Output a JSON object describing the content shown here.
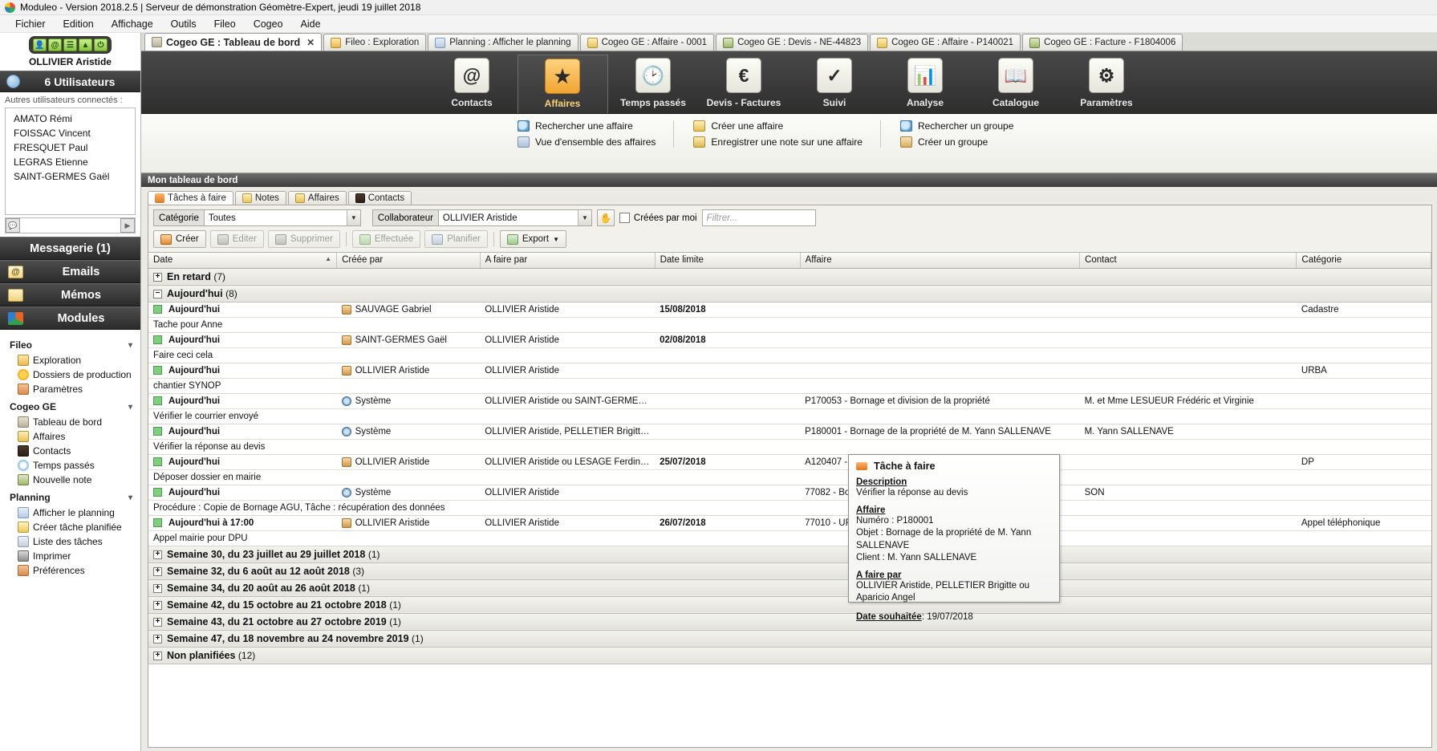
{
  "window": {
    "title": "Moduleo - Version 2018.2.5 | Serveur de démonstration Géomètre-Expert, jeudi 19 juillet 2018",
    "logo_icon": "moduleo-logo-icon"
  },
  "menubar": [
    "Fichier",
    "Edition",
    "Affichage",
    "Outils",
    "Fileo",
    "Cogeo",
    "Aide"
  ],
  "sidebar": {
    "quick_icons": [
      "user-icon",
      "at-icon",
      "contacts-icon",
      "map-icon",
      "power-icon"
    ],
    "current_user": "OLLIVIER Aristide",
    "users_header": "6 Utilisateurs",
    "connected_label": "Autres utilisateurs connectés :",
    "connected_users": [
      "AMATO Rémi",
      "FOISSAC Vincent",
      "FRESQUET Paul",
      "LEGRAS Etienne",
      "SAINT-GERMES Gaël"
    ],
    "bars": [
      {
        "label": "Messagerie (1)",
        "icon": ""
      },
      {
        "label": "Emails",
        "icon": "at-icon"
      },
      {
        "label": "Mémos",
        "icon": "memo-icon"
      },
      {
        "label": "Modules",
        "icon": "modules-icon"
      }
    ],
    "groups": [
      {
        "title": "Fileo",
        "items": [
          {
            "label": "Exploration",
            "icon": "folder-explore-icon"
          },
          {
            "label": "Dossiers de production",
            "icon": "star-icon"
          },
          {
            "label": "Paramètres",
            "icon": "wrench-icon"
          }
        ]
      },
      {
        "title": "Cogeo GE",
        "items": [
          {
            "label": "Tableau de bord",
            "icon": "home-icon"
          },
          {
            "label": "Affaires",
            "icon": "affair-folder-icon"
          },
          {
            "label": "Contacts",
            "icon": "contacts-book-icon"
          },
          {
            "label": "Temps passés",
            "icon": "clock-icon"
          },
          {
            "label": "Nouvelle note",
            "icon": "new-note-icon"
          }
        ]
      },
      {
        "title": "Planning",
        "items": [
          {
            "label": "Afficher le planning",
            "icon": "calendar-icon"
          },
          {
            "label": "Créer tâche planifiée",
            "icon": "task-icon"
          },
          {
            "label": "Liste des tâches",
            "icon": "list-icon"
          },
          {
            "label": "Imprimer",
            "icon": "printer-icon"
          },
          {
            "label": "Préférences",
            "icon": "preferences-icon"
          }
        ]
      }
    ]
  },
  "tabs": [
    {
      "label": "Cogeo GE : Tableau de bord",
      "icon": "home-icon",
      "active": true,
      "closable": true
    },
    {
      "label": "Fileo : Exploration",
      "icon": "folder-explore-icon",
      "active": false
    },
    {
      "label": "Planning : Afficher le planning",
      "icon": "calendar-icon",
      "active": false
    },
    {
      "label": "Cogeo GE : Affaire - 0001",
      "icon": "affair-folder-icon",
      "active": false
    },
    {
      "label": "Cogeo GE : Devis - NE-44823",
      "icon": "quote-icon",
      "active": false
    },
    {
      "label": "Cogeo GE : Affaire - P140021",
      "icon": "affair-folder-icon",
      "active": false
    },
    {
      "label": "Cogeo GE : Facture - F1804006",
      "icon": "invoice-icon",
      "active": false
    }
  ],
  "ribbon": [
    {
      "label": "Contacts",
      "glyph": "@",
      "icon": "contacts-icon",
      "active": false
    },
    {
      "label": "Affaires",
      "glyph": "★",
      "icon": "affairs-icon",
      "active": true
    },
    {
      "label": "Temps passés",
      "glyph": "◷",
      "icon": "clock-icon",
      "active": false
    },
    {
      "label": "Devis - Factures",
      "glyph": "€",
      "icon": "euro-icon",
      "active": false
    },
    {
      "label": "Suivi",
      "glyph": "✓",
      "icon": "check-icon",
      "active": false
    },
    {
      "label": "Analyse",
      "glyph": "▊",
      "icon": "chart-icon",
      "active": false
    },
    {
      "label": "Catalogue",
      "glyph": "▤",
      "icon": "book-icon",
      "active": false
    },
    {
      "label": "Paramètres",
      "glyph": "✿",
      "icon": "gear-icon",
      "active": false
    }
  ],
  "quick_links": {
    "col1": [
      {
        "label": "Rechercher une affaire",
        "icon": "search-icon"
      },
      {
        "label": "Vue d'ensemble des affaires",
        "icon": "grid-icon"
      }
    ],
    "col2": [
      {
        "label": "Créer une affaire",
        "icon": "new-affair-icon"
      },
      {
        "label": "Enregistrer une note sur une affaire",
        "icon": "note-icon"
      }
    ],
    "col3": [
      {
        "label": "Rechercher un groupe",
        "icon": "search-icon"
      },
      {
        "label": "Créer un groupe",
        "icon": "new-group-icon"
      }
    ]
  },
  "dashboard": {
    "title": "Mon tableau de bord",
    "inner_tabs": [
      {
        "label": "Tâches à faire",
        "icon": "arrow-icon",
        "active": true
      },
      {
        "label": "Notes",
        "icon": "note-icon",
        "active": false
      },
      {
        "label": "Affaires",
        "icon": "affair-folder-icon",
        "active": false
      },
      {
        "label": "Contacts",
        "icon": "contacts-book-icon",
        "active": false
      }
    ],
    "filters": {
      "categorie_label": "Catégorie",
      "categorie_value": "Toutes",
      "collaborateur_label": "Collaborateur",
      "collaborateur_value": "OLLIVIER Aristide",
      "hand_icon": "hand-icon",
      "creees_par_moi_label": "Créées par moi",
      "creees_par_moi_checked": false,
      "filter_placeholder": "Filtrer..."
    },
    "buttons": [
      {
        "label": "Créer",
        "icon": "create-icon",
        "disabled": false
      },
      {
        "label": "Editer",
        "icon": "edit-icon",
        "disabled": true
      },
      {
        "label": "Supprimer",
        "icon": "delete-icon",
        "disabled": true
      },
      {
        "label": "Effectuée",
        "icon": "done-icon",
        "disabled": true
      },
      {
        "label": "Planifier",
        "icon": "plan-icon",
        "disabled": true
      },
      {
        "label": "Export",
        "icon": "export-icon",
        "disabled": false,
        "dropdown": true
      }
    ],
    "columns": [
      "Date",
      "Créée par",
      "A faire par",
      "Date limite",
      "Affaire",
      "Contact",
      "Catégorie"
    ],
    "sort_column": "Date",
    "rows": [
      {
        "type": "group",
        "label": "En retard",
        "count": "(7)",
        "expanded": false
      },
      {
        "type": "group",
        "label": "Aujourd'hui",
        "count": "(8)",
        "expanded": true
      },
      {
        "type": "task",
        "date": "Aujourd'hui",
        "creee_par": "SAUVAGE Gabriel",
        "creator_icon": "person-icon",
        "a_faire_par": "OLLIVIER Aristide",
        "date_limite": "15/08/2018",
        "affaire": "",
        "contact": "",
        "categorie": "Cadastre"
      },
      {
        "type": "sub",
        "text": "Tache pour Anne"
      },
      {
        "type": "task",
        "date": "Aujourd'hui",
        "creee_par": "SAINT-GERMES Gaël",
        "creator_icon": "person-icon",
        "a_faire_par": "OLLIVIER Aristide",
        "date_limite": "02/08/2018",
        "affaire": "",
        "contact": "",
        "categorie": ""
      },
      {
        "type": "sub",
        "text": "Faire ceci cela"
      },
      {
        "type": "task",
        "date": "Aujourd'hui",
        "creee_par": "OLLIVIER Aristide",
        "creator_icon": "person-icon",
        "a_faire_par": "OLLIVIER Aristide",
        "date_limite": "",
        "affaire": "",
        "contact": "",
        "categorie": "URBA"
      },
      {
        "type": "sub",
        "text": "chantier SYNOP"
      },
      {
        "type": "task",
        "date": "Aujourd'hui",
        "creee_par": "Système",
        "creator_icon": "system-icon",
        "a_faire_par": "OLLIVIER Aristide ou SAINT-GERMES Gaël",
        "date_limite": "",
        "affaire": "P170053 - Bornage et division de la propriété",
        "contact": "M. et Mme LESUEUR Frédéric et Virginie",
        "categorie": ""
      },
      {
        "type": "sub",
        "text": "Vérifier le courrier envoyé"
      },
      {
        "type": "task",
        "date": "Aujourd'hui",
        "creee_par": "Système",
        "creator_icon": "system-icon",
        "a_faire_par": "OLLIVIER Aristide, PELLETIER Brigitte ou A...",
        "date_limite": "",
        "affaire": "P180001 - Bornage de la propriété de M. Yann SALLENAVE",
        "contact": "M. Yann SALLENAVE",
        "categorie": ""
      },
      {
        "type": "sub",
        "text": "Vérifier la réponse au devis"
      },
      {
        "type": "task",
        "date": "Aujourd'hui",
        "creee_par": "OLLIVIER Aristide",
        "creator_icon": "person-icon",
        "a_faire_par": "OLLIVIER Aristide ou LESAGE Ferdinand",
        "date_limite": "25/07/2018",
        "affaire": "A120407 - BORNAGE",
        "contact": "",
        "categorie": "DP"
      },
      {
        "type": "sub",
        "text": "Déposer dossier en mairie"
      },
      {
        "type": "task",
        "date": "Aujourd'hui",
        "creee_par": "Système",
        "creator_icon": "system-icon",
        "a_faire_par": "OLLIVIER Aristide",
        "date_limite": "",
        "affaire": "77082 - Bornage entre les parcell",
        "contact": "SON",
        "categorie": ""
      },
      {
        "type": "sub",
        "text": "Procédure : Copie de Bornage AGU, Tâche : récupération des données"
      },
      {
        "type": "task",
        "date": "Aujourd'hui à 17:00",
        "creee_par": "OLLIVIER Aristide",
        "creator_icon": "person-icon",
        "a_faire_par": "OLLIVIER Aristide",
        "date_limite": "26/07/2018",
        "affaire": "77010 - URBANISME",
        "contact": "",
        "categorie": "Appel téléphonique"
      },
      {
        "type": "sub",
        "text": "Appel mairie pour DPU"
      },
      {
        "type": "group",
        "label": "Semaine 30, du 23 juillet au 29 juillet 2018",
        "count": "(1)",
        "expanded": false
      },
      {
        "type": "group",
        "label": "Semaine 32, du 6 août au 12 août 2018",
        "count": "(3)",
        "expanded": false
      },
      {
        "type": "group",
        "label": "Semaine 34, du 20 août au 26 août 2018",
        "count": "(1)",
        "expanded": false
      },
      {
        "type": "group",
        "label": "Semaine 42, du 15 octobre au 21 octobre 2018",
        "count": "(1)",
        "expanded": false
      },
      {
        "type": "group",
        "label": "Semaine 43, du 21 octobre au 27 octobre 2019",
        "count": "(1)",
        "expanded": false
      },
      {
        "type": "group",
        "label": "Semaine 47, du 18 novembre au 24 novembre 2019",
        "count": "(1)",
        "expanded": false
      },
      {
        "type": "group",
        "label": "Non planifiées",
        "count": "(12)",
        "expanded": false
      }
    ]
  },
  "tooltip": {
    "icon": "arrow-icon",
    "title": "Tâche à faire",
    "description_label": "Description",
    "description_value": "Vérifier la réponse au devis",
    "affaire_label": "Affaire",
    "affaire_numero": "Numéro : P180001",
    "affaire_objet": "Objet : Bornage de la propriété de M. Yann SALLENAVE",
    "affaire_client": "Client : M. Yann SALLENAVE",
    "afaire_label": "A faire par",
    "afaire_value": "OLLIVIER Aristide, PELLETIER Brigitte ou Aparicio Angel",
    "date_label": "Date souhaitée",
    "date_value": ": 19/07/2018"
  }
}
